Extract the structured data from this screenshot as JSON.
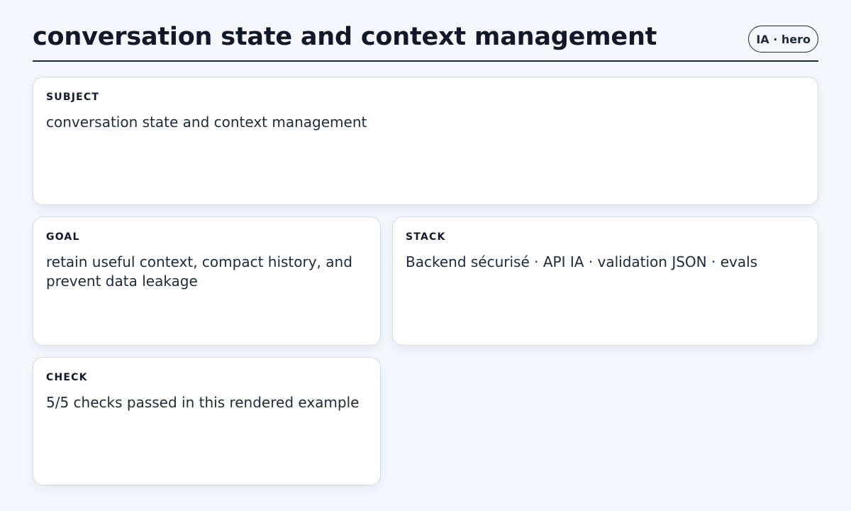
{
  "header": {
    "title": "conversation state and context management",
    "badge": "IA · hero"
  },
  "cards": {
    "subject": {
      "label": "SUBJECT",
      "value": "conversation state and context management"
    },
    "goal": {
      "label": "GOAL",
      "value": "retain useful context, compact history, and prevent data leakage"
    },
    "stack": {
      "label": "STACK",
      "value": "Backend sécurisé · API IA · validation JSON · evals"
    },
    "check": {
      "label": "CHECK",
      "value": "5/5 checks passed in this rendered example"
    }
  }
}
